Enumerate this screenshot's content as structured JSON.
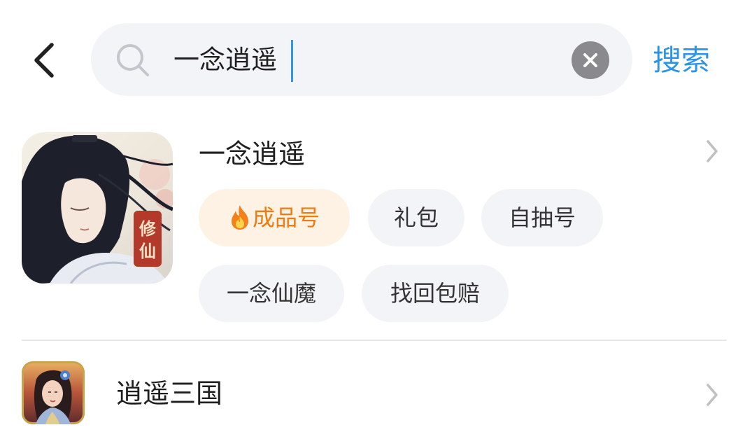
{
  "header": {
    "back_icon": "chevron-left-icon",
    "search_icon": "search-icon",
    "query": "一念逍遥",
    "clear_icon": "close-icon",
    "submit_label": "搜索"
  },
  "results": [
    {
      "title": "一念逍遥",
      "icon_badge": "修仙",
      "tags": [
        {
          "label": "成品号",
          "hot": true,
          "icon": "fire-icon"
        },
        {
          "label": "礼包"
        },
        {
          "label": "自抽号"
        },
        {
          "label": "一念仙魔"
        },
        {
          "label": "找回包赔"
        }
      ],
      "arrow_icon": "chevron-right-icon"
    },
    {
      "title": "逍遥三国",
      "arrow_icon": "chevron-right-icon"
    }
  ],
  "colors": {
    "accent": "#2b94e8",
    "hot_tag_text": "#f07b12",
    "hot_tag_bg": "#fdf2e3",
    "tag_bg": "#f3f4f8",
    "search_bg": "#f3f4f8"
  }
}
